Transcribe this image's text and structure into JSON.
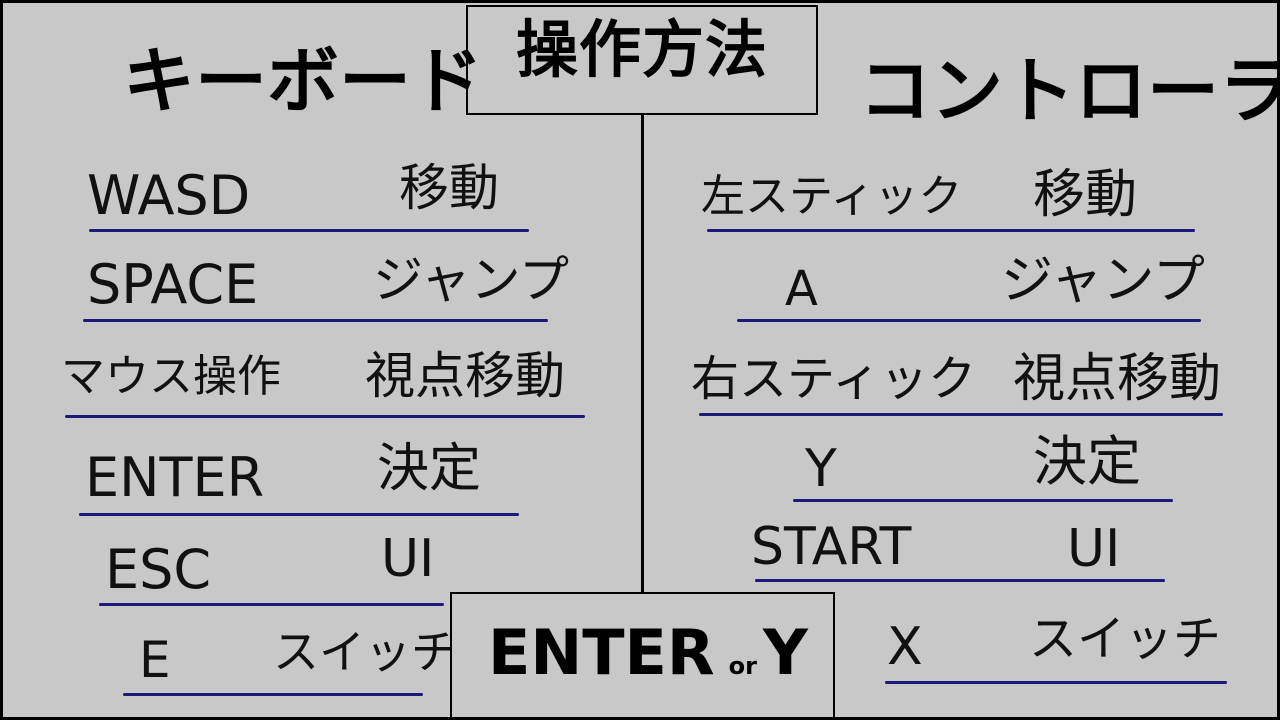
{
  "title": "操作方法",
  "keyboard": {
    "heading": "キーボード",
    "rows": [
      {
        "key": "WASD",
        "action": "移動"
      },
      {
        "key": "SPACE",
        "action": "ジャンプ"
      },
      {
        "key": "マウス操作",
        "action": "視点移動"
      },
      {
        "key": "ENTER",
        "action": "決定"
      },
      {
        "key": "ESC",
        "action": "UI"
      },
      {
        "key": "E",
        "action": "スイッチ"
      }
    ]
  },
  "controller": {
    "heading": "コントローラ",
    "rows": [
      {
        "key": "左スティック",
        "action": "移動"
      },
      {
        "key": "A",
        "action": "ジャンプ"
      },
      {
        "key": "右スティック",
        "action": "視点移動"
      },
      {
        "key": "Y",
        "action": "決定"
      },
      {
        "key": "START",
        "action": "UI"
      },
      {
        "key": "X",
        "action": "スイッチ"
      }
    ]
  },
  "confirm": {
    "primary": "ENTER",
    "joiner": "or",
    "secondary": "Y"
  },
  "colors": {
    "background": "#c8c8c8",
    "underline": "#1b1a7a",
    "text": "#000000"
  }
}
